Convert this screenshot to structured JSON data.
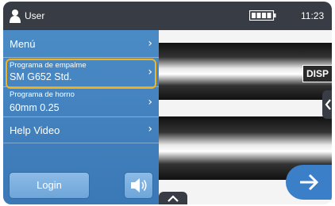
{
  "header": {
    "user_label": "User",
    "time": "11:23"
  },
  "menu": {
    "menu_label": "Menú",
    "splice_label": "Programa de empalme",
    "splice_value": "SM G652 Std.",
    "oven_label": "Programa de horno",
    "oven_value": "60mm 0.25",
    "help_label": "Help Video"
  },
  "footer": {
    "login_label": "Login"
  },
  "viewer": {
    "disp_label": "DISP"
  },
  "colors": {
    "panel_blue": "#4d8ec8",
    "header_dark": "#383c44",
    "highlight": "#f2b31c"
  },
  "icons": [
    "user-icon",
    "chevron-right-icon",
    "speaker-icon",
    "battery-icon",
    "chevron-left-icon",
    "arrow-right-icon",
    "chevron-up-icon"
  ]
}
